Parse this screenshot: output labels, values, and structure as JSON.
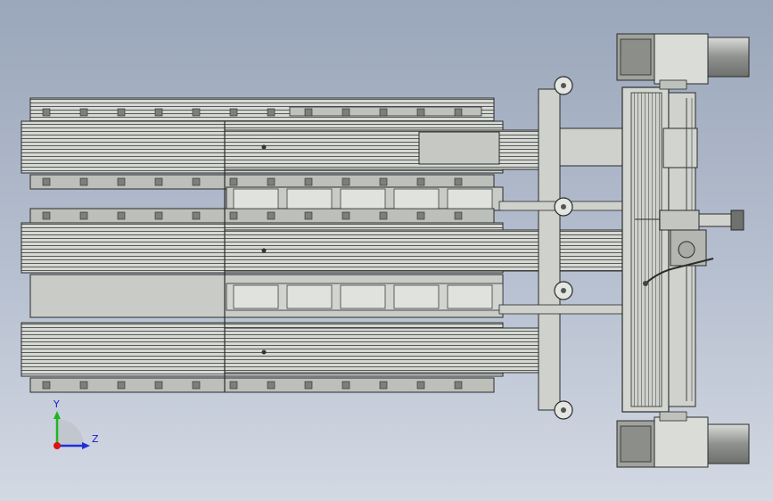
{
  "viewport": {
    "background_top": "#9aa6ba",
    "background_bottom": "#d3d9e3"
  },
  "model": {
    "frame_color": "#d8dad6",
    "shade_color": "#9c9e9a",
    "edge_color": "#2a2c2a",
    "motor_color": "#a8aaa8"
  },
  "triad": {
    "y_label": "Y",
    "z_label": "Z",
    "y_color": "#1fb51f",
    "z_color": "#1f2fd8",
    "origin_color": "#e01010"
  }
}
